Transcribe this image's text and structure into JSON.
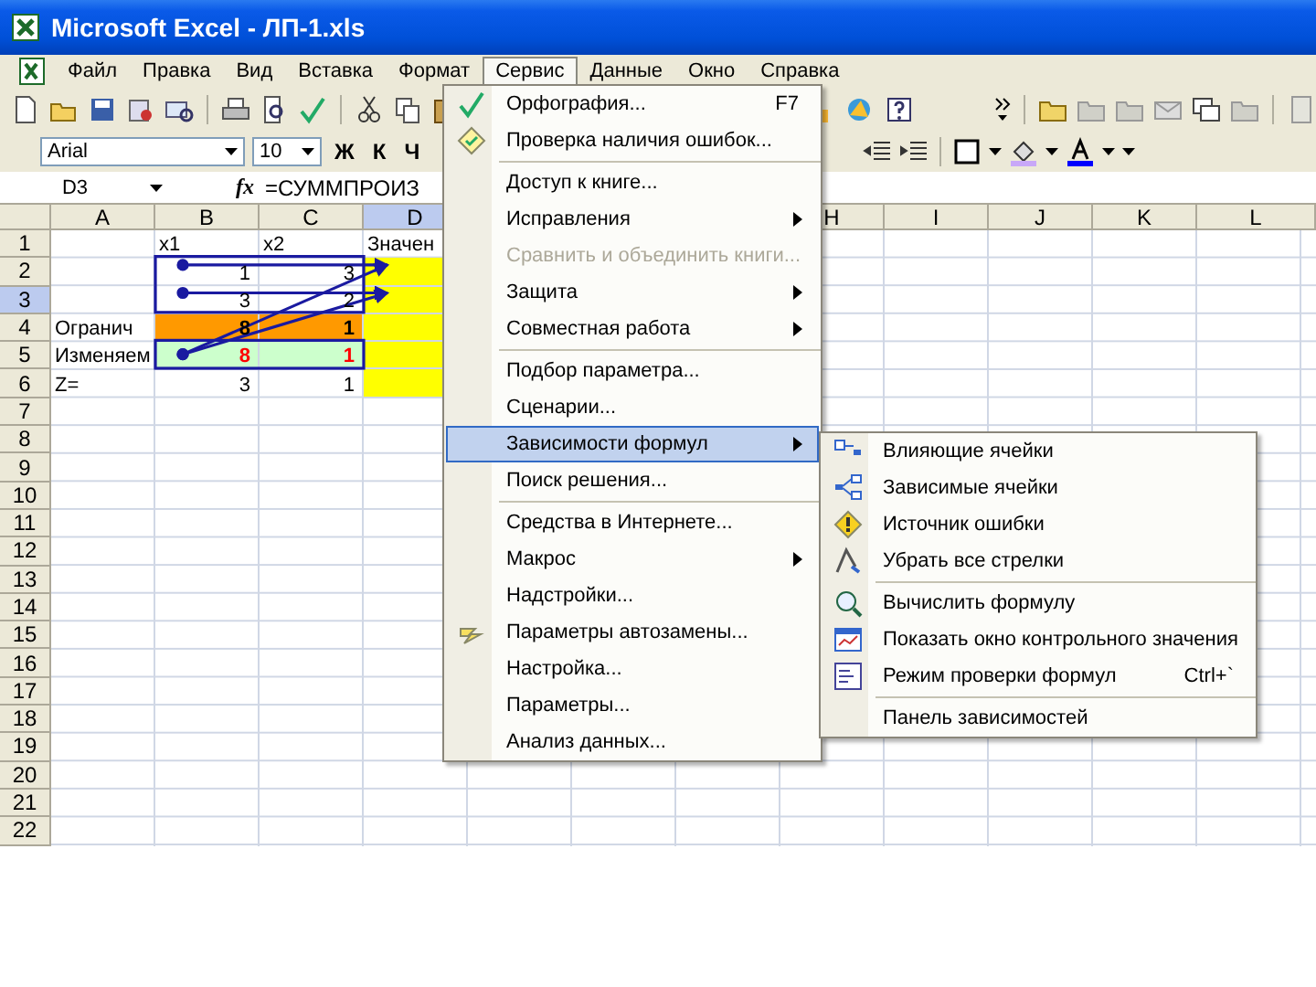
{
  "window": {
    "title": "Microsoft Excel - ЛП-1.xls"
  },
  "menu_bar": [
    {
      "label": "Файл",
      "selected": false
    },
    {
      "label": "Правка",
      "selected": false
    },
    {
      "label": "Вид",
      "selected": false
    },
    {
      "label": "Вставка",
      "selected": false
    },
    {
      "label": "Формат",
      "selected": false
    },
    {
      "label": "Сервис",
      "selected": true
    },
    {
      "label": "Данные",
      "selected": false
    },
    {
      "label": "Окно",
      "selected": false
    },
    {
      "label": "Справка",
      "selected": false
    }
  ],
  "formatting_toolbar": {
    "font": "Arial",
    "size": "10",
    "style_buttons": [
      "Ж",
      "К",
      "Ч"
    ]
  },
  "formula_bar": {
    "name_box": "D3",
    "function_label": "fx",
    "formula": "=СУММПРОИЗ"
  },
  "sheet": {
    "columns": [
      {
        "label": "A",
        "selected": false
      },
      {
        "label": "B",
        "selected": false
      },
      {
        "label": "C",
        "selected": false
      },
      {
        "label": "D",
        "selected": true
      },
      {
        "label": "H",
        "selected": false
      },
      {
        "label": "I",
        "selected": false
      },
      {
        "label": "J",
        "selected": false
      },
      {
        "label": "K",
        "selected": false
      },
      {
        "label": "L",
        "selected": false
      }
    ],
    "rows": [
      {
        "label": "1",
        "selected": false,
        "cells": [
          {
            "kind": "blank"
          },
          {
            "kind": "text",
            "text": "x1"
          },
          {
            "kind": "text",
            "text": "x2"
          },
          {
            "kind": "text",
            "text": "Значен"
          }
        ]
      },
      {
        "label": "2",
        "selected": false,
        "cells": [
          {
            "kind": "blank"
          },
          {
            "kind": "number",
            "text": "1"
          },
          {
            "kind": "number",
            "text": "3"
          },
          {
            "kind": "fill",
            "color": "#ffff00"
          }
        ]
      },
      {
        "label": "3",
        "selected": true,
        "cells": [
          {
            "kind": "blank"
          },
          {
            "kind": "number",
            "text": "3"
          },
          {
            "kind": "number",
            "text": "2"
          },
          {
            "kind": "fill",
            "color": "#ffff00"
          }
        ]
      },
      {
        "label": "4",
        "selected": false,
        "cells": [
          {
            "kind": "text",
            "text": "Огранич"
          },
          {
            "kind": "number",
            "text": "8",
            "color": "#ff9900",
            "bold": true
          },
          {
            "kind": "number",
            "text": "1",
            "color": "#ff9900",
            "bold": true
          },
          {
            "kind": "fill",
            "color": "#ffff00"
          }
        ]
      },
      {
        "label": "5",
        "selected": false,
        "cells": [
          {
            "kind": "text",
            "text": "Изменяем"
          },
          {
            "kind": "number",
            "text": "8",
            "color": "#ccffcc",
            "highlight": true,
            "bold": true
          },
          {
            "kind": "number",
            "text": "1",
            "color": "#ccffcc",
            "highlight": true,
            "bold": true
          },
          {
            "kind": "fill",
            "color": "#ffff00"
          }
        ]
      },
      {
        "label": "6",
        "selected": false,
        "cells": [
          {
            "kind": "text",
            "text": "Z="
          },
          {
            "kind": "number",
            "text": "3"
          },
          {
            "kind": "number",
            "text": "1"
          },
          {
            "kind": "fill",
            "color": "#ffff00"
          }
        ]
      },
      {
        "label": "7",
        "selected": false
      },
      {
        "label": "8",
        "selected": false
      },
      {
        "label": "9",
        "selected": false
      },
      {
        "label": "10",
        "selected": false
      },
      {
        "label": "11",
        "selected": false
      },
      {
        "label": "12",
        "selected": false
      },
      {
        "label": "13",
        "selected": false
      },
      {
        "label": "14",
        "selected": false
      },
      {
        "label": "15",
        "selected": false
      },
      {
        "label": "16",
        "selected": false
      },
      {
        "label": "17",
        "selected": false
      },
      {
        "label": "18",
        "selected": false
      },
      {
        "label": "19",
        "selected": false
      },
      {
        "label": "20",
        "selected": false
      },
      {
        "label": "21",
        "selected": false
      },
      {
        "label": "22",
        "selected": false
      }
    ]
  },
  "tools_menu": {
    "groups": [
      [
        {
          "label": "Орфография...",
          "shortcut": "F7",
          "submenu": false,
          "disabled": false,
          "selected": false
        },
        {
          "label": "Проверка наличия ошибок...",
          "submenu": false,
          "disabled": false,
          "selected": false
        }
      ],
      [
        {
          "label": "Доступ к книге...",
          "submenu": false,
          "disabled": false,
          "selected": false
        },
        {
          "label": "Исправления",
          "submenu": true,
          "disabled": false,
          "selected": false
        },
        {
          "label": "Сравнить и объединить книги...",
          "submenu": false,
          "disabled": true,
          "selected": false
        },
        {
          "label": "Защита",
          "submenu": true,
          "disabled": false,
          "selected": false
        },
        {
          "label": "Совместная работа",
          "submenu": true,
          "disabled": false,
          "selected": false
        }
      ],
      [
        {
          "label": "Подбор параметра...",
          "submenu": false,
          "disabled": false,
          "selected": false
        },
        {
          "label": "Сценарии...",
          "submenu": false,
          "disabled": false,
          "selected": false
        },
        {
          "label": "Зависимости формул",
          "submenu": true,
          "disabled": false,
          "selected": true,
          "open_submenu": {
            "groups": [
              [
                {
                  "label": "Влияющие ячейки",
                  "selected": false
                },
                {
                  "label": "Зависимые ячейки",
                  "selected": false
                },
                {
                  "label": "Источник ошибки",
                  "selected": false
                },
                {
                  "label": "Убрать все стрелки",
                  "selected": false
                }
              ],
              [
                {
                  "label": "Вычислить формулу",
                  "selected": false
                },
                {
                  "label": "Показать окно контрольного значения",
                  "selected": false
                },
                {
                  "label": "Режим проверки формул",
                  "shortcut": "Ctrl+`",
                  "selected": false
                }
              ],
              [
                {
                  "label": "Панель зависимостей",
                  "selected": false
                }
              ]
            ]
          }
        },
        {
          "label": "Поиск решения...",
          "submenu": false,
          "disabled": false,
          "selected": false
        }
      ],
      [
        {
          "label": "Средства в Интернете...",
          "submenu": false,
          "disabled": false,
          "selected": false
        },
        {
          "label": "Макрос",
          "submenu": true,
          "disabled": false,
          "selected": false
        },
        {
          "label": "Надстройки...",
          "submenu": false,
          "disabled": false,
          "selected": false
        },
        {
          "label": "Параметры автозамены...",
          "submenu": false,
          "disabled": false,
          "selected": false
        },
        {
          "label": "Настройка...",
          "submenu": false,
          "disabled": false,
          "selected": false
        },
        {
          "label": "Параметры...",
          "submenu": false,
          "disabled": false,
          "selected": false
        },
        {
          "label": "Анализ данных...",
          "submenu": false,
          "disabled": false,
          "selected": false
        }
      ]
    ]
  }
}
